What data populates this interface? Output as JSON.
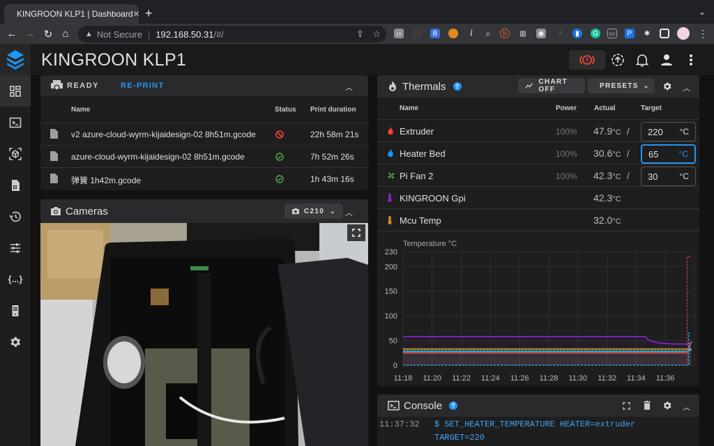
{
  "browser": {
    "tab_title": "KINGROON KLP1 | Dashboard",
    "tab_close": "✕",
    "new_tab": "+",
    "security_label": "Not Secure",
    "url_host": "192.168.50.31",
    "url_path": "/#/"
  },
  "app": {
    "title": "KINGROON KLP1",
    "accent": "#2196f3"
  },
  "sidebar": {
    "items": [
      {
        "name": "dashboard",
        "active": true
      },
      {
        "name": "console"
      },
      {
        "name": "heightmap"
      },
      {
        "name": "jobs"
      },
      {
        "name": "history"
      },
      {
        "name": "tune"
      },
      {
        "name": "macros"
      },
      {
        "name": "machine"
      },
      {
        "name": "settings"
      }
    ]
  },
  "status_panel": {
    "state": "READY",
    "reprint_label": "RE-PRINT",
    "columns": {
      "name": "Name",
      "status": "Status",
      "duration": "Print duration"
    },
    "jobs": [
      {
        "name": "v2 azure-cloud-wyrm-kijaidesign-02 8h51m.gcode",
        "status": "cancelled",
        "duration": "22h 58m 21s"
      },
      {
        "name": "azure-cloud-wyrm-kijaidesign-02 8h51m.gcode",
        "status": "completed",
        "duration": "7h 52m 26s"
      },
      {
        "name": "弹簧 1h42m.gcode",
        "status": "completed",
        "duration": "1h 43m 16s"
      }
    ]
  },
  "cameras": {
    "title": "Cameras",
    "selected_camera": "C210"
  },
  "thermals": {
    "title": "Thermals",
    "chart_toggle_label": "CHART OFF",
    "presets_label": "PRESETS",
    "columns": {
      "name": "Name",
      "power": "Power",
      "actual": "Actual",
      "target": "Target"
    },
    "unit": "°C",
    "sensors": [
      {
        "name": "Extruder",
        "power": "100%",
        "actual": "47.9",
        "target": "220",
        "color": "#f44336"
      },
      {
        "name": "Heater Bed",
        "power": "100%",
        "actual": "30.6",
        "target": "65",
        "color": "#2196f3"
      },
      {
        "name": "Pi Fan 2",
        "power": "100%",
        "actual": "42.3",
        "target": "30",
        "color": "#4caf50"
      },
      {
        "name": "KINGROON Gpi",
        "actual": "42.3",
        "color": "#8e24d8"
      },
      {
        "name": "Mcu Temp",
        "actual": "32.0",
        "color": "#e68a1f"
      }
    ]
  },
  "chart_data": {
    "type": "line",
    "title": "Temperature °C",
    "xlabel": "",
    "ylabel": "Temperature °C",
    "x_ticks": [
      "11:18",
      "11:20",
      "11:22",
      "11:24",
      "11:26",
      "11:28",
      "11:30",
      "11:32",
      "11:34",
      "11:36"
    ],
    "y_ticks": [
      0,
      50,
      100,
      150,
      200,
      230
    ],
    "ylim": [
      0,
      230
    ],
    "xlim_minutes": [
      0,
      20
    ],
    "grid": true,
    "series": [
      {
        "name": "KINGROON Gpi",
        "color": "#8e24d8",
        "points": [
          [
            0,
            58
          ],
          [
            16.6,
            58
          ],
          [
            16.9,
            50
          ],
          [
            17.5,
            45
          ],
          [
            18.5,
            43
          ],
          [
            19.6,
            43
          ],
          [
            19.8,
            45
          ]
        ]
      },
      {
        "name": "Mcu Temp",
        "color": "#e68a1f",
        "points": [
          [
            0,
            33
          ],
          [
            19.8,
            33
          ]
        ]
      },
      {
        "name": "Pi Fan 2",
        "color": "#4caf50",
        "points": [
          [
            0,
            31
          ],
          [
            19.8,
            31
          ]
        ],
        "dashed": true
      },
      {
        "name": "Heater Bed",
        "color": "#29b6f6",
        "points": [
          [
            0,
            28
          ],
          [
            19.5,
            28
          ],
          [
            19.8,
            31
          ]
        ]
      },
      {
        "name": "Extruder",
        "color": "#f06060",
        "points": [
          [
            0,
            25
          ],
          [
            19.5,
            25
          ],
          [
            19.8,
            48
          ]
        ]
      },
      {
        "name": "Extruder target",
        "color": "#c0403c",
        "points": [
          [
            0,
            0
          ],
          [
            19.5,
            0
          ],
          [
            19.5,
            220
          ],
          [
            19.8,
            220
          ]
        ],
        "dashed": true
      },
      {
        "name": "Heater Bed target",
        "color": "#29b6f6",
        "points": [
          [
            0,
            0
          ],
          [
            19.6,
            0
          ],
          [
            19.6,
            65
          ],
          [
            19.8,
            65
          ]
        ],
        "dashed": true
      }
    ]
  },
  "console": {
    "title": "Console",
    "entries": [
      {
        "time": "11:37:32",
        "command": "$ SET_HEATER_TEMPERATURE HEATER=extruder",
        "continuation": "TARGET=220"
      }
    ]
  }
}
